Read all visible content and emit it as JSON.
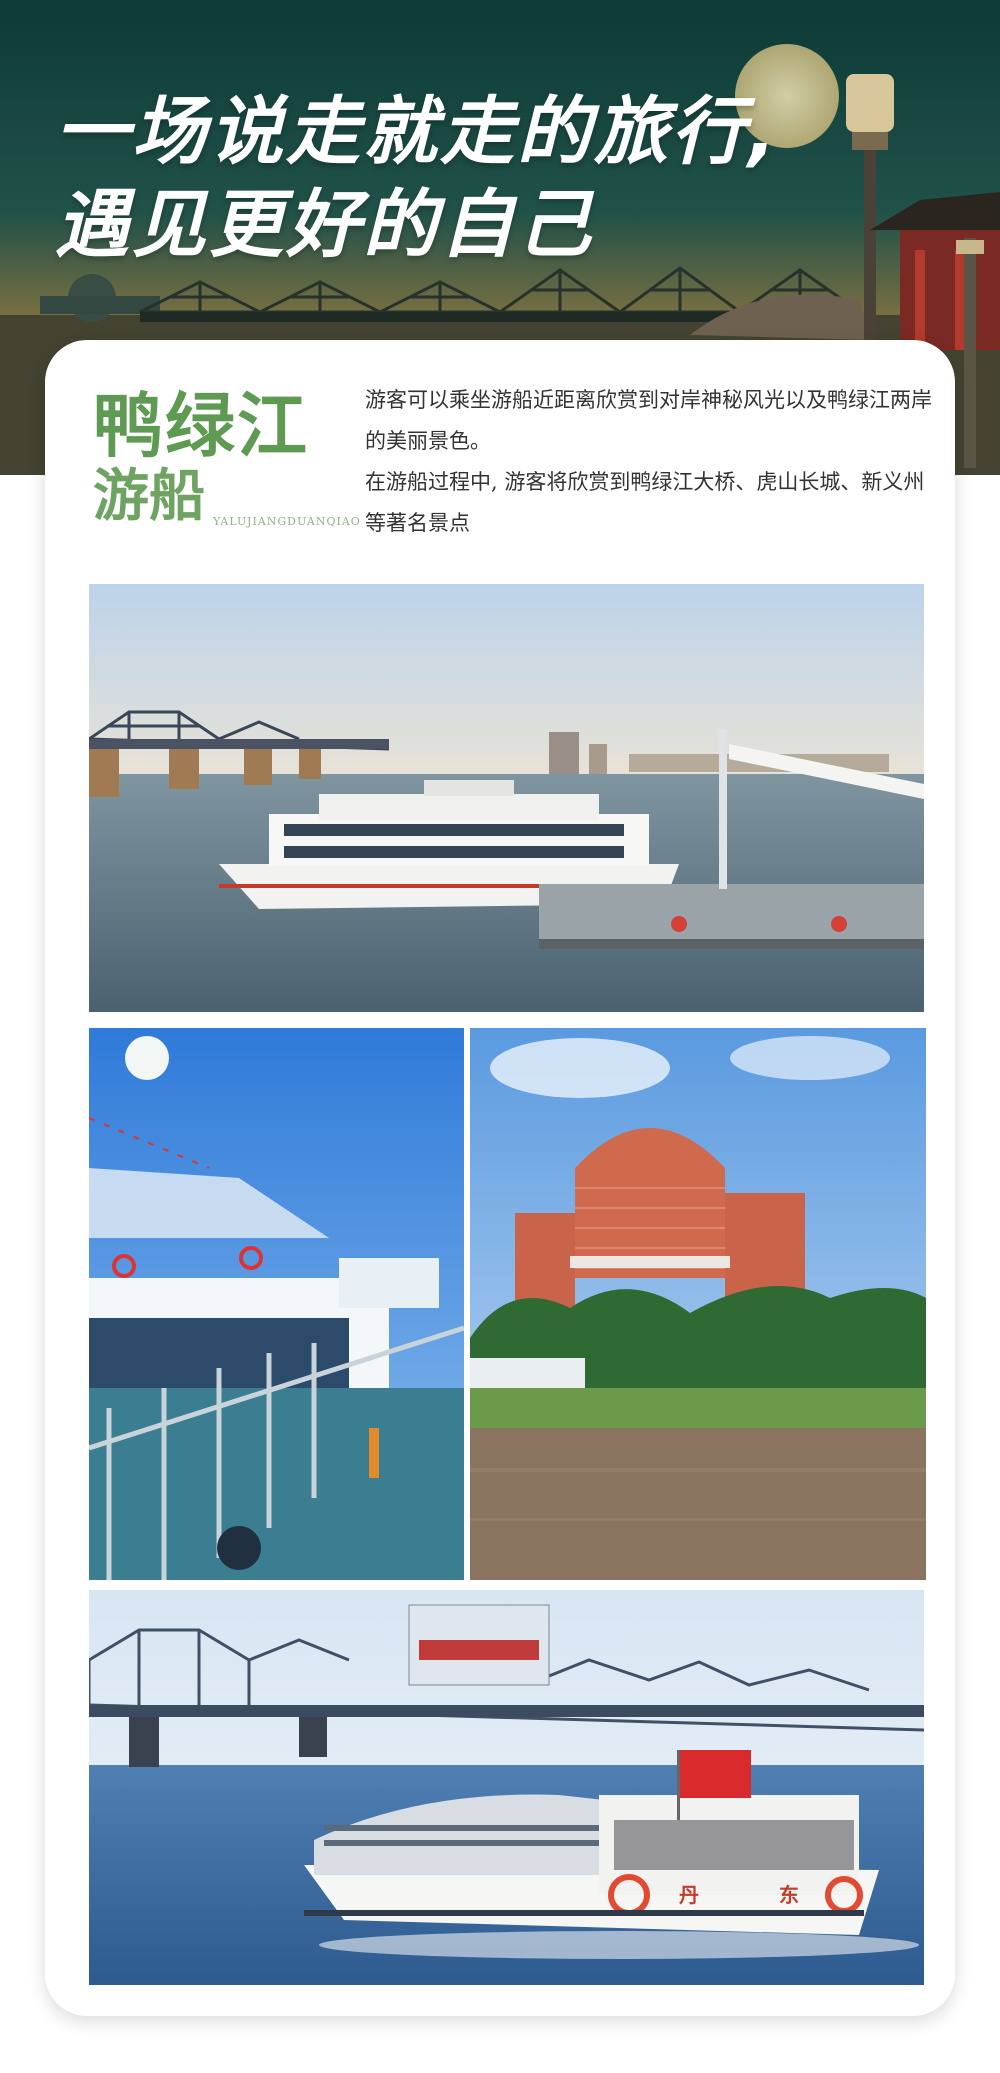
{
  "hero": {
    "line1": "一场说走就走的旅行,",
    "line2": "遇见更好的自己"
  },
  "card": {
    "title_line1": "鸭绿江",
    "title_line2": "游船",
    "pinyin": "YALUJIANGDUANQIAO",
    "desc_p1": "游客可以乘坐游船近距离欣赏到对岸神秘风光以及鸭绿江两岸的美丽景色。",
    "desc_p2": "在游船过程中, 游客将欣赏到鸭绿江大桥、虎山长城、新义州等著名景点"
  },
  "photos": {
    "photo4_boat_text_1": "丹",
    "photo4_boat_text_2": "东"
  },
  "colors": {
    "title_green": "#5e9a52",
    "hero_dark": "#0f3a34",
    "hero_glow": "#e8a64a"
  }
}
